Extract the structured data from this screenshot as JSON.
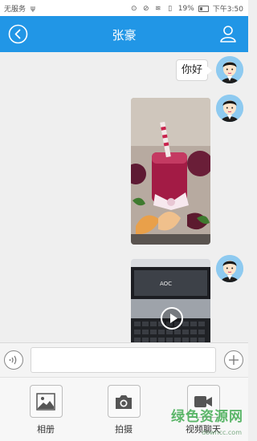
{
  "status_bar": {
    "carrier": "无服务",
    "battery": "19%",
    "time": "下午3:50"
  },
  "header": {
    "title": "张豪",
    "back_icon": "back-circle-icon",
    "profile_icon": "user-profile-icon",
    "color": "#2196e6"
  },
  "messages": [
    {
      "type": "text",
      "text": "你好",
      "sender": "self"
    },
    {
      "type": "image",
      "content": "juice-photo",
      "sender": "self"
    },
    {
      "type": "video",
      "content": "monitor-keyboard-video",
      "sender": "self",
      "monitor_brand": "AOC"
    }
  ],
  "input_bar": {
    "voice_icon": "voice-icon",
    "input_value": "",
    "input_placeholder": "",
    "plus_icon": "plus-icon"
  },
  "toolbar": {
    "album_label": "相册",
    "camera_label": "拍摄",
    "video_chat_label": "视频聊天"
  },
  "watermark": {
    "text": "绿色资源网",
    "sub": "downcc.com"
  }
}
